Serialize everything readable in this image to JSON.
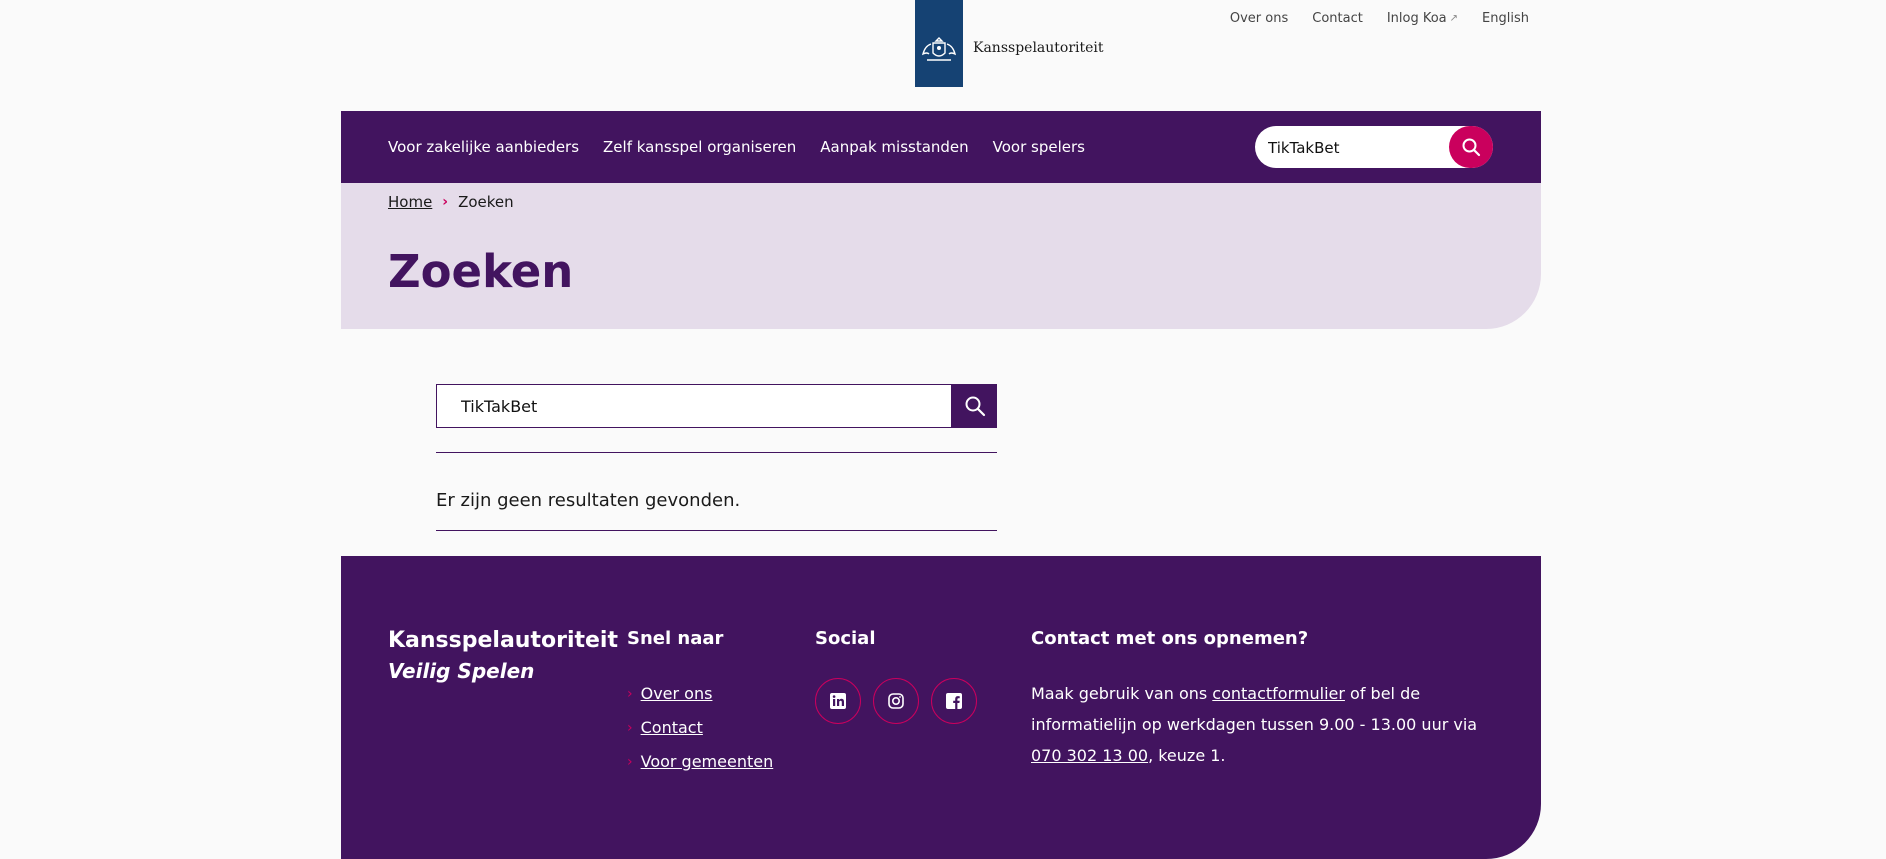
{
  "header": {
    "logo_text": "Kansspelautoriteit",
    "service_nav": [
      "Over ons",
      "Contact",
      "Inlog Koa",
      "English"
    ]
  },
  "mainnav": {
    "items": [
      "Voor zakelijke aanbieders",
      "Zelf kansspel organiseren",
      "Aanpak misstanden",
      "Voor spelers"
    ],
    "search_value": "TikTakBet"
  },
  "breadcrumb": {
    "home": "Home",
    "current": "Zoeken"
  },
  "page_title": "Zoeken",
  "search": {
    "value": "TikTakBet"
  },
  "results": {
    "message": "Er zijn geen resultaten gevonden."
  },
  "footer": {
    "brand_name": "Kansspelautoriteit",
    "brand_tagline": "Veilig Spelen",
    "quick_title": "Snel naar",
    "quick_links": [
      "Over ons",
      "Contact",
      "Voor gemeenten"
    ],
    "social_title": "Social",
    "social_icons": [
      "linkedin-icon",
      "instagram-icon",
      "facebook-icon"
    ],
    "contact_title": "Contact met ons opnemen?",
    "contact_p1": "Maak gebruik van ons ",
    "contact_link": "contactformulier",
    "contact_p2": " of bel de informatielijn op werkdagen tussen 9.00 - 13.00 uur via ",
    "contact_phone": "070 302 13 00",
    "contact_p3": ", keuze 1."
  },
  "colors": {
    "purple": "#42145f",
    "magenta": "#ca005d",
    "lavender": "#e5dcea",
    "logo_blue": "#154273"
  }
}
